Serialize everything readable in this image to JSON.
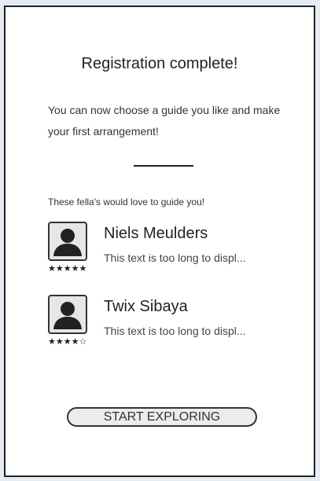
{
  "title": "Registration complete!",
  "intro": "You can now choose a guide you like and make your first arrangement!",
  "subhead": "These fella's would love to guide you!",
  "guides": [
    {
      "name": "Niels Meulders",
      "description": "This text is too long to displ...",
      "stars": "★★★★★",
      "rating": 5,
      "avatar_icon": "user-silhouette-icon"
    },
    {
      "name": "Twix Sibaya",
      "description": "This text is too long to displ...",
      "stars": "★★★★☆",
      "rating": 4,
      "avatar_icon": "user-silhouette-icon"
    }
  ],
  "cta_label": "START EXPLORING"
}
